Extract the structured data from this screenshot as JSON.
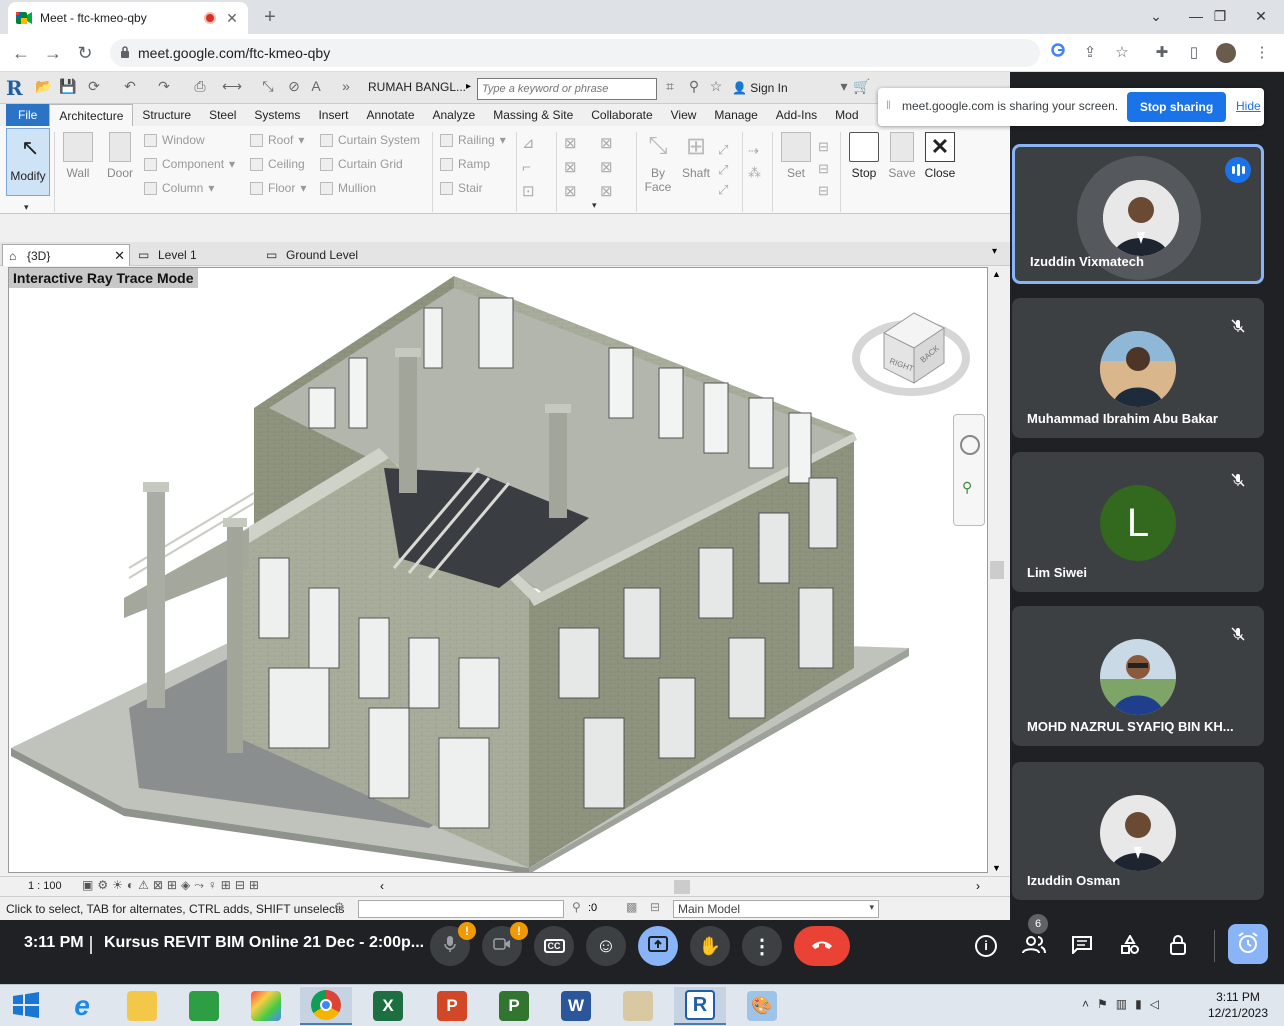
{
  "browser": {
    "tab_title": "Meet - ftc-kmeo-qby",
    "url": "meet.google.com/ftc-kmeo-qby"
  },
  "revit": {
    "app_logo": "R",
    "doc_title": "RUMAH BANGL...",
    "search_placeholder": "Type a keyword or phrase",
    "sign_in": "Sign In",
    "ribbon_tabs": [
      "File",
      "Architecture",
      "Structure",
      "Steel",
      "Systems",
      "Insert",
      "Annotate",
      "Analyze",
      "Massing & Site",
      "Collaborate",
      "View",
      "Manage",
      "Add-Ins",
      "Mod"
    ],
    "modify": "Modify",
    "build": {
      "wall": "Wall",
      "door": "Door",
      "window": "Window",
      "component": "Component",
      "column": "Column",
      "roof": "Roof",
      "ceiling": "Ceiling",
      "floor": "Floor",
      "curtain_system": "Curtain System",
      "curtain_grid": "Curtain Grid",
      "mullion": "Mullion",
      "railing": "Railing",
      "ramp": "Ramp",
      "stair": "Stair"
    },
    "by_face": "By\nFace",
    "by_face_1": "By",
    "by_face_2": "Face",
    "shaft": "Shaft",
    "set": "Set",
    "stop": "Stop",
    "save": "Save",
    "close": "Close",
    "view_tabs": [
      "{3D}",
      "Level 1",
      "Ground Level"
    ],
    "ray_trace": "Interactive Ray Trace Mode",
    "viewcube_right": "RIGHT",
    "viewcube_back": "BACK",
    "scale": "1 : 100",
    "status_msg": "Click to select, TAB for alternates, CTRL adds, SHIFT unselects",
    "filter_count": ":0",
    "model": "Main Model"
  },
  "share_banner": {
    "text": "meet.google.com is sharing your screen.",
    "stop": "Stop sharing",
    "hide": "Hide"
  },
  "participants": [
    {
      "name": "Izuddin Vixmatech",
      "avatar": "photo-suit",
      "speaking": true
    },
    {
      "name": "Muhammad Ibrahim Abu Bakar",
      "avatar": "photo-boy",
      "muted": true
    },
    {
      "name": "Lim Siwei",
      "initial": "L",
      "avatar_color": "#33691e",
      "muted": true
    },
    {
      "name": "MOHD NAZRUL SYAFIQ BIN KH...",
      "avatar": "photo-man-outdoor",
      "muted": true
    },
    {
      "name": "Izuddin Osman",
      "avatar": "photo-suit"
    }
  ],
  "meetbar": {
    "time": "3:11 PM",
    "meeting_name": "Kursus REVIT BIM Online 21 Dec - 2:00p...",
    "people_count": "6"
  },
  "taskbar": {
    "time": "3:11 PM",
    "date": "12/21/2023"
  }
}
